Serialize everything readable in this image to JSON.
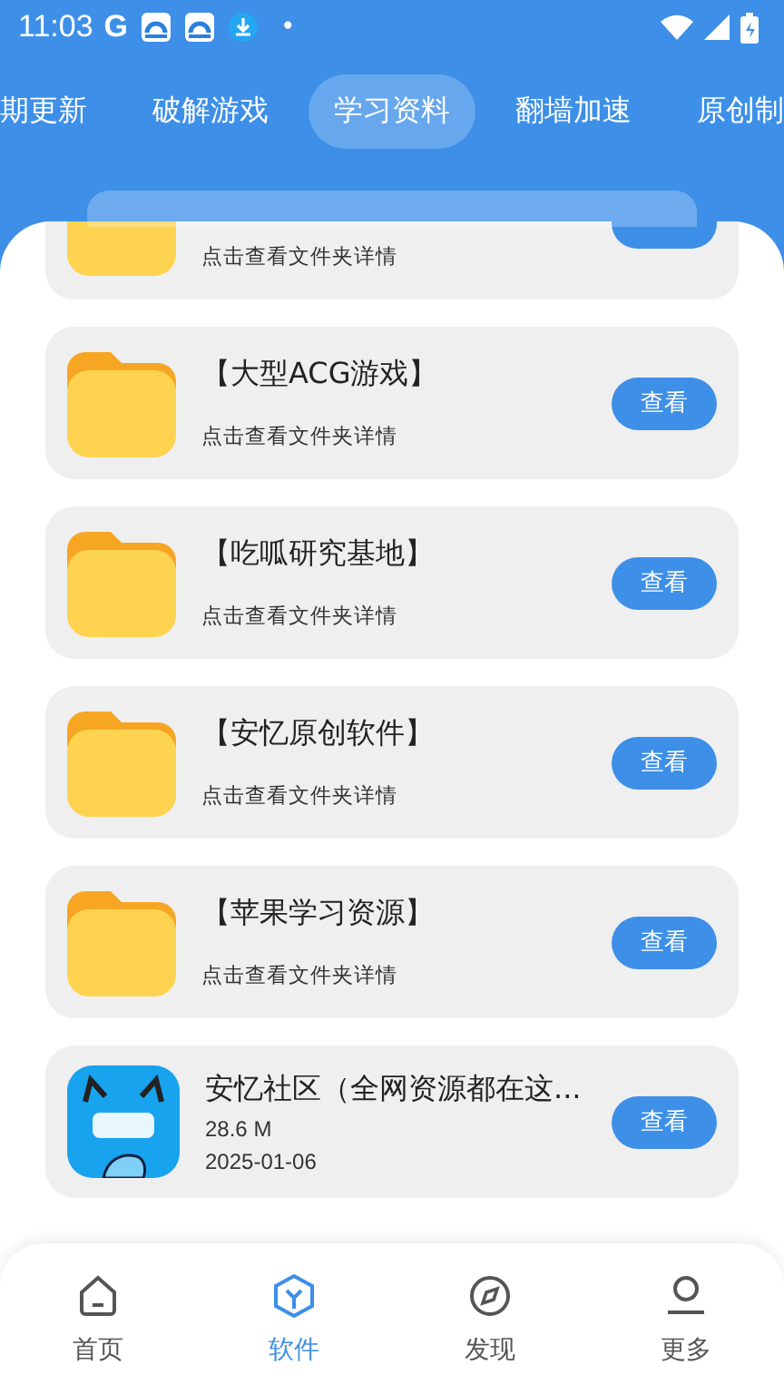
{
  "status_bar": {
    "time": "11:03",
    "carrier": "G",
    "dot": "•"
  },
  "tabs": [
    {
      "label": "期更新",
      "selected": false
    },
    {
      "label": "破解游戏",
      "selected": false
    },
    {
      "label": "学习资料",
      "selected": true
    },
    {
      "label": "翻墙加速",
      "selected": false
    },
    {
      "label": "原创制",
      "selected": false
    }
  ],
  "items": [
    {
      "kind": "folder_partial",
      "subtitle": "点击查看文件夹详情"
    },
    {
      "kind": "folder",
      "title": "【大型ACG游戏】",
      "subtitle": "点击查看文件夹详情",
      "button": "查看"
    },
    {
      "kind": "folder",
      "title": "【吃呱研究基地】",
      "subtitle": "点击查看文件夹详情",
      "button": "查看"
    },
    {
      "kind": "folder",
      "title": "【安忆原创软件】",
      "subtitle": "点击查看文件夹详情",
      "button": "查看"
    },
    {
      "kind": "folder",
      "title": "【苹果学习资源】",
      "subtitle": "点击查看文件夹详情",
      "button": "查看"
    },
    {
      "kind": "app",
      "title": "安忆社区（全网资源都在这...",
      "size": "28.6 M",
      "date": "2025-01-06",
      "button": "查看"
    }
  ],
  "nav": [
    {
      "label": "首页",
      "selected": false
    },
    {
      "label": "软件",
      "selected": true
    },
    {
      "label": "发现",
      "selected": false
    },
    {
      "label": "更多",
      "selected": false
    }
  ]
}
